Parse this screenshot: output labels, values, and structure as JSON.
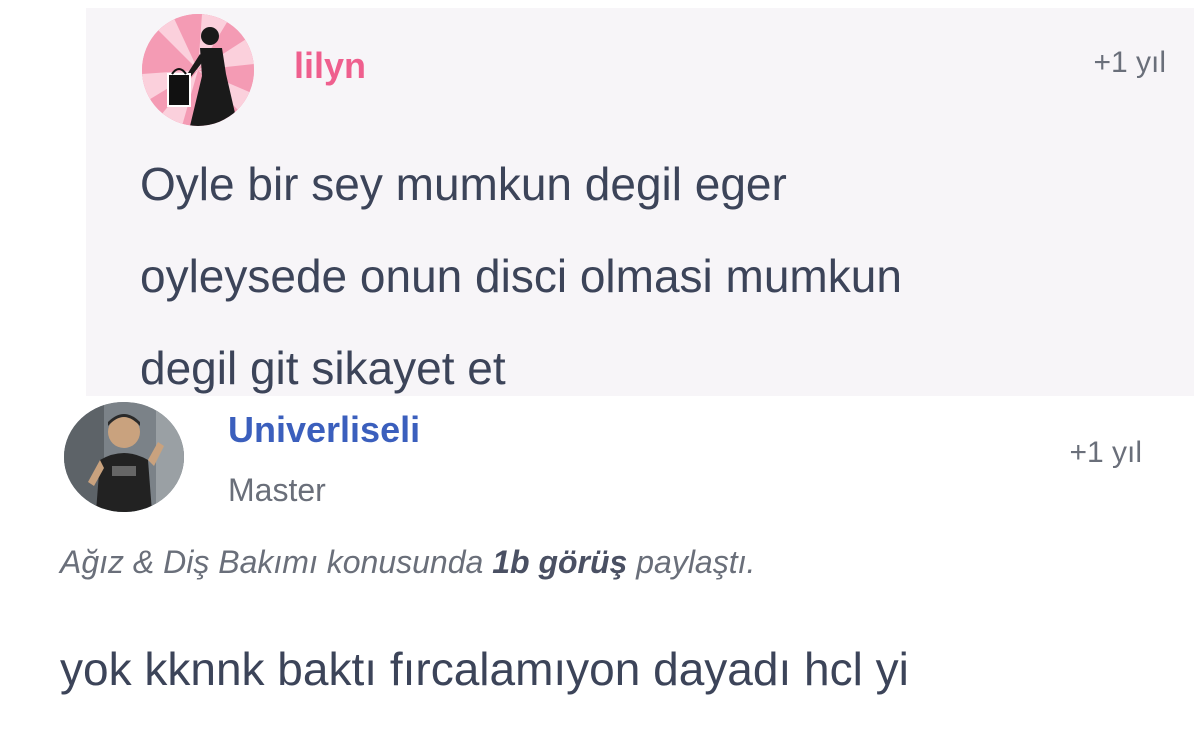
{
  "reply": {
    "user": {
      "name": "lilyn",
      "avatar_icon": "profile-avatar-icon"
    },
    "time": "+1 yıl",
    "lines": [
      "Oyle bir sey mumkun degil eger",
      "oyleysede onun disci olmasi mumkun",
      "degil git sikayet et"
    ]
  },
  "comment": {
    "user": {
      "name": "Univerliseli",
      "rank": "Master",
      "avatar_icon": "profile-avatar-icon"
    },
    "time": "+1 yıl",
    "context": {
      "prefix": "Ağız & Diş Bakımı konusunda ",
      "highlight": "1b görüş",
      "suffix": " paylaştı."
    },
    "text": "yok kknnk baktı fırcalamıyon dayadı hcl yi"
  },
  "colors": {
    "reply_bg": "#f7f5f8",
    "reply_name": "#ef5f8e",
    "comment_name": "#3b5fbd",
    "body_text": "#3c4459",
    "muted_text": "#6a6f7a"
  }
}
